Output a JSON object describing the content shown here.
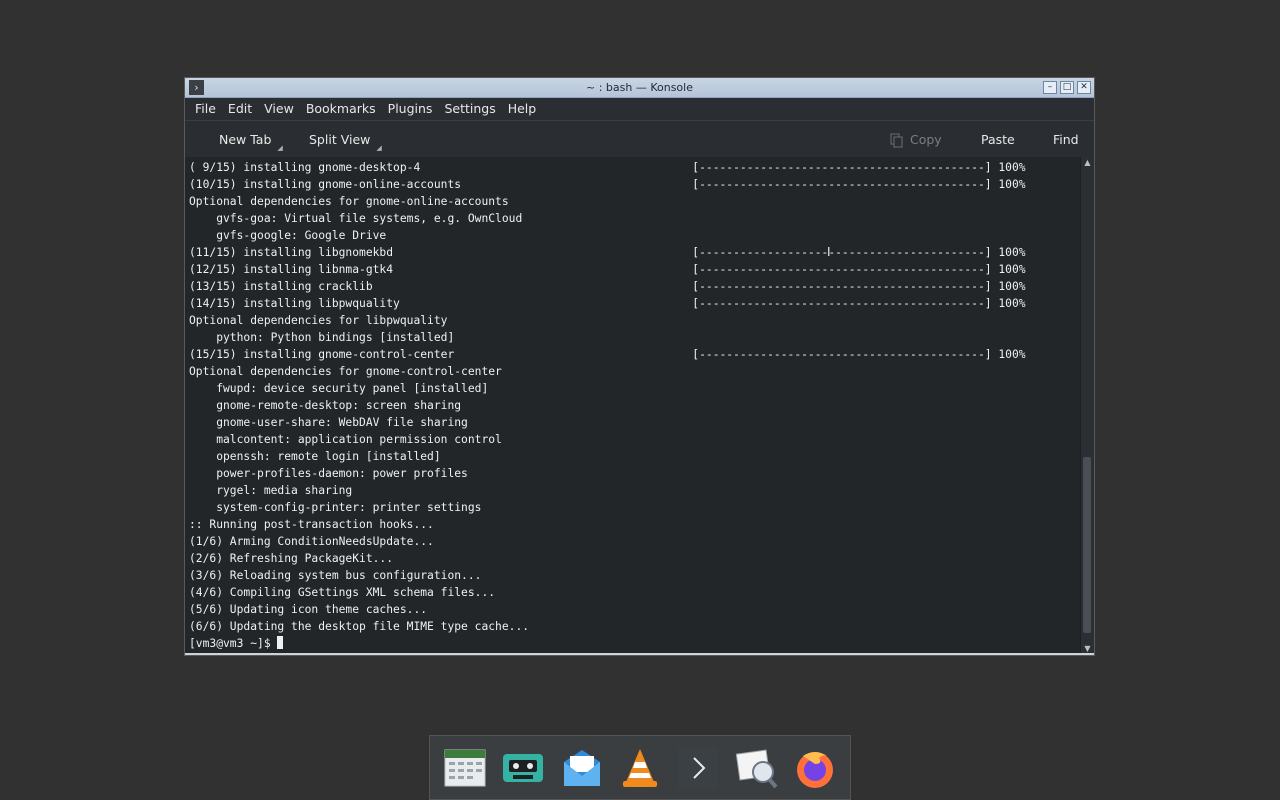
{
  "window": {
    "title": "~ : bash — Konsole",
    "controls": [
      "minimize",
      "maximize",
      "close"
    ]
  },
  "menubar": {
    "items": [
      "File",
      "Edit",
      "View",
      "Bookmarks",
      "Plugins",
      "Settings",
      "Help"
    ]
  },
  "toolbar": {
    "new_tab": "New Tab",
    "split_view": "Split View",
    "copy": "Copy",
    "paste": "Paste",
    "find": "Find"
  },
  "terminal": {
    "lines": [
      "( 9/15) installing gnome-desktop-4                                        [------------------------------------------] 100%",
      "(10/15) installing gnome-online-accounts                                  [------------------------------------------] 100%",
      "Optional dependencies for gnome-online-accounts",
      "    gvfs-goa: Virtual file systems, e.g. OwnCloud",
      "    gvfs-google: Google Drive",
      "(11/15) installing libgnomekbd                                            [------------------------------------------] 100%",
      "(12/15) installing libnma-gtk4                                            [------------------------------------------] 100%",
      "(13/15) installing cracklib                                               [------------------------------------------] 100%",
      "(14/15) installing libpwquality                                           [------------------------------------------] 100%",
      "Optional dependencies for libpwquality",
      "    python: Python bindings [installed]",
      "(15/15) installing gnome-control-center                                   [------------------------------------------] 100%",
      "Optional dependencies for gnome-control-center",
      "    fwupd: device security panel [installed]",
      "    gnome-remote-desktop: screen sharing",
      "    gnome-user-share: WebDAV file sharing",
      "    malcontent: application permission control",
      "    openssh: remote login [installed]",
      "    power-profiles-daemon: power profiles",
      "    rygel: media sharing",
      "    system-config-printer: printer settings",
      ":: Running post-transaction hooks...",
      "(1/6) Arming ConditionNeedsUpdate...",
      "(2/6) Refreshing PackageKit...",
      "(3/6) Reloading system bus configuration...",
      "(4/6) Compiling GSettings XML schema files...",
      "(5/6) Updating icon theme caches...",
      "(6/6) Updating the desktop file MIME type cache..."
    ],
    "prompt": "[vm3@vm3 ~]$ "
  },
  "dock": {
    "items": [
      "calendar-app-icon",
      "tape-player-app-icon",
      "mail-app-icon",
      "vlc-app-icon",
      "terminal-app-icon",
      "image-viewer-app-icon",
      "firefox-app-icon"
    ]
  },
  "colors": {
    "desktop": "#313131",
    "terminal_bg": "#232629",
    "terminal_fg": "#eff0f1",
    "titlebar": "#c2d0e2"
  }
}
